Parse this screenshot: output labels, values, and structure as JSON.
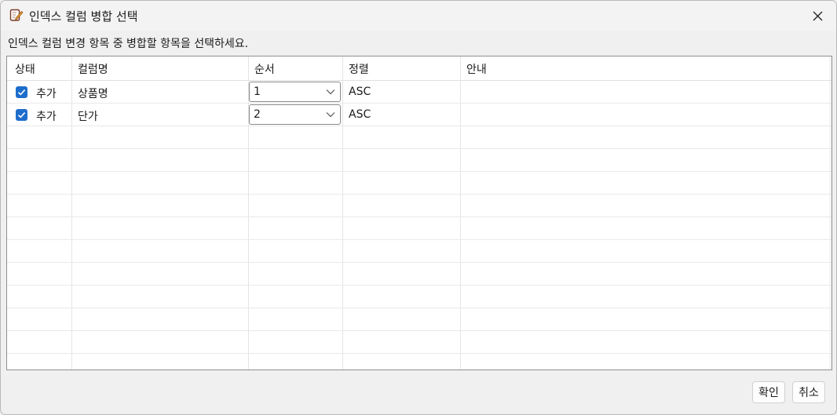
{
  "window": {
    "title": "인덱스 컬럼 병합 선택"
  },
  "instruction": "인덱스 컬럼 변경 항목 중 병합할 항목을 선택하세요.",
  "table": {
    "headers": [
      "상태",
      "컬럼명",
      "순서",
      "정렬",
      "안내"
    ],
    "rows": [
      {
        "checked": true,
        "status": "추가",
        "column": "상품명",
        "order": "1",
        "sort": "ASC",
        "note": ""
      },
      {
        "checked": true,
        "status": "추가",
        "column": "단가",
        "order": "2",
        "sort": "ASC",
        "note": ""
      }
    ]
  },
  "buttons": {
    "ok": "확인",
    "cancel": "취소"
  },
  "colors": {
    "accent": "#1d6dcc"
  },
  "icons": {
    "title": "edit-document-icon",
    "close": "close-icon",
    "dropdown": "chevron-down-icon",
    "check": "checkmark-icon"
  }
}
